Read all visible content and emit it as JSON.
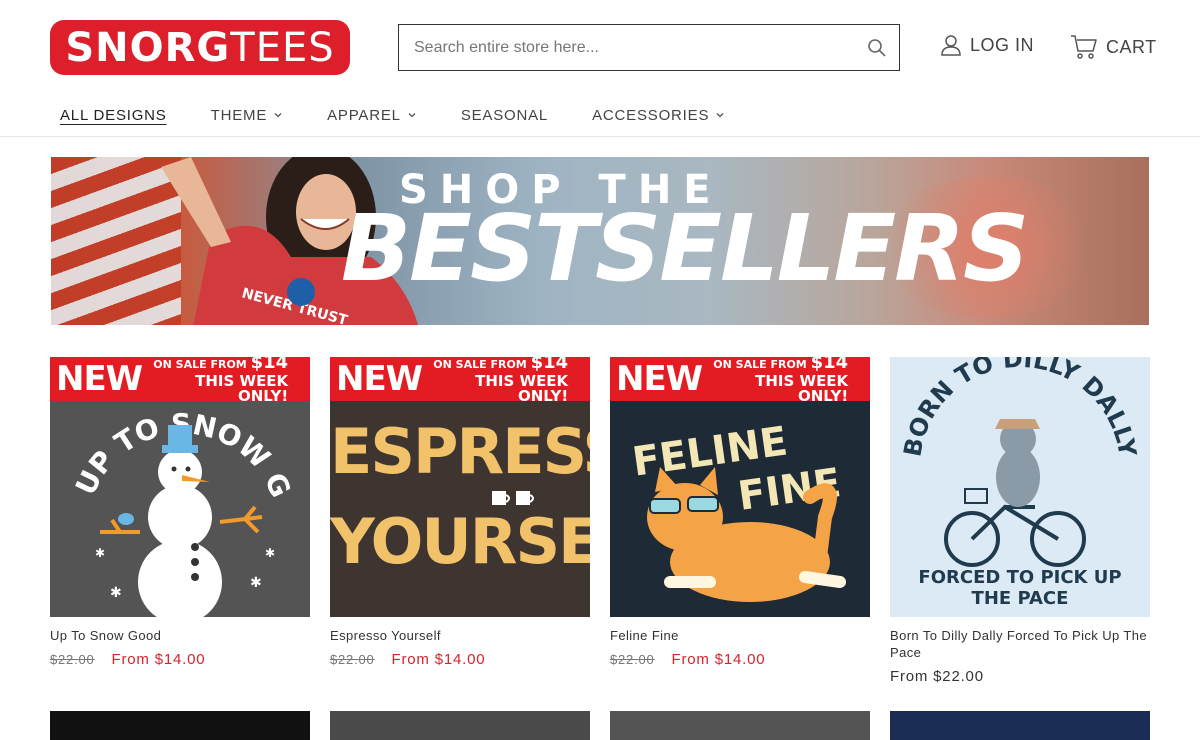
{
  "brand": {
    "logo_text_bold": "SNORG",
    "logo_text_light": "TEES",
    "color": "#dc1f2b"
  },
  "search": {
    "placeholder": "Search entire store here..."
  },
  "account": {
    "login_label": "LOG IN",
    "cart_label": "CART"
  },
  "nav": {
    "items": [
      {
        "label": "ALL DESIGNS",
        "has_dropdown": false,
        "active": true
      },
      {
        "label": "THEME",
        "has_dropdown": true
      },
      {
        "label": "APPAREL",
        "has_dropdown": true
      },
      {
        "label": "SEASONAL",
        "has_dropdown": false
      },
      {
        "label": "ACCESSORIES",
        "has_dropdown": true
      }
    ]
  },
  "banner": {
    "line1": "SHOP THE",
    "line2": "BESTSELLERS"
  },
  "sale_badge": {
    "new": "NEW",
    "line1_small": "ON SALE FROM",
    "line1_price": "$14",
    "line2": "THIS WEEK ONLY!"
  },
  "products": [
    {
      "title": "Up To Snow Good",
      "old_price": "$22.00",
      "price": "From $14.00",
      "on_sale": true,
      "art": "UP TO SNOW GOOD",
      "bg": "#545454"
    },
    {
      "title": "Espresso Yourself",
      "old_price": "$22.00",
      "price": "From $14.00",
      "on_sale": true,
      "art_line1": "ESPRESSO",
      "art_line2": "YOURSELF",
      "bg": "#3f3530"
    },
    {
      "title": "Feline Fine",
      "old_price": "$22.00",
      "price": "From $14.00",
      "on_sale": true,
      "art_line1": "FELINE",
      "art_line2": "FINE",
      "bg": "#1e2a36"
    },
    {
      "title": "Born To Dilly Dally Forced To Pick Up The Pace",
      "price": "From $22.00",
      "on_sale": false,
      "art_top": "BORN TO DILLY DALLY",
      "art_bottom_1": "FORCED TO PICK UP",
      "art_bottom_2": "THE PACE",
      "bg": "#dbeaf5"
    }
  ],
  "colors": {
    "sale_red": "#e31b23",
    "price_red": "#d8222d"
  }
}
